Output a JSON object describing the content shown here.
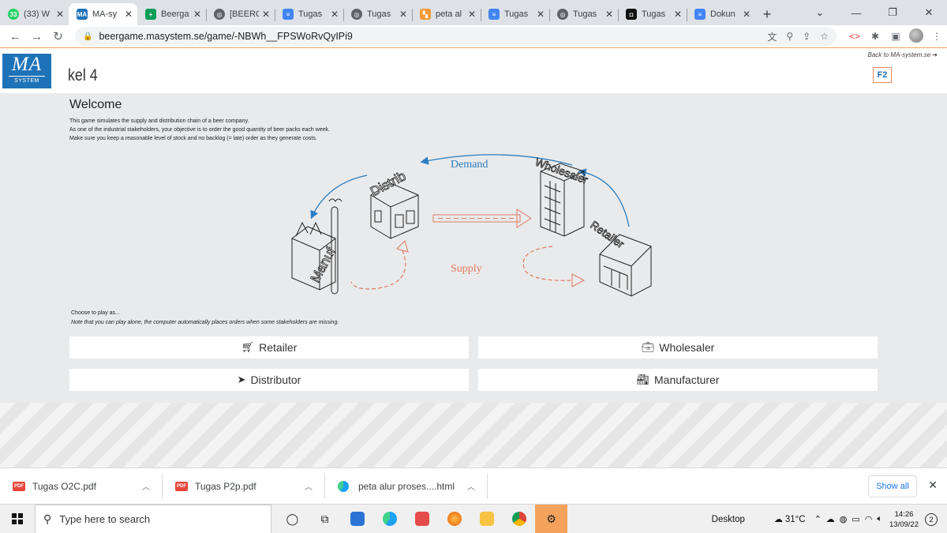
{
  "browser": {
    "tabs": [
      {
        "title": "(33) W",
        "fav_text": "33",
        "fav_color": "#25d366"
      },
      {
        "title": "MA-sy",
        "fav_text": "MA",
        "fav_color": "#1e73b8",
        "active": true
      },
      {
        "title": "Beerga",
        "fav_text": "+",
        "fav_color": "#0f9d58"
      },
      {
        "title": "[BEERG",
        "fav_text": "◎",
        "fav_color": "#5f6368"
      },
      {
        "title": "Tugas",
        "fav_text": "≡",
        "fav_color": "#4285f4"
      },
      {
        "title": "Tugas",
        "fav_text": "◎",
        "fav_color": "#5f6368"
      },
      {
        "title": "peta al",
        "fav_text": "▚",
        "fav_color": "#f29b38"
      },
      {
        "title": "Tugas",
        "fav_text": "≡",
        "fav_color": "#4285f4"
      },
      {
        "title": "Tugas",
        "fav_text": "◎",
        "fav_color": "#5f6368"
      },
      {
        "title": "Tugas",
        "fav_text": "◘",
        "fav_color": "#111111"
      },
      {
        "title": "Dokun",
        "fav_text": "≡",
        "fav_color": "#4285f4"
      }
    ],
    "new_tab": "+",
    "url": "beergame.masystem.se/game/-NBWh__FPSWoRvQyIPi9"
  },
  "page": {
    "logo_text": "MA",
    "logo_sub": "SYSTEM",
    "game_name": "kel 4",
    "back_link": "Back to MA-system.se ➔",
    "flag_text": "F2",
    "welcome_title": "Welcome",
    "intro_lines": [
      "This game simulates the supply and distribution chain of a beer company.",
      "As one of the industrial stakeholders, your objective is to order the good quantity of beer packs each week.",
      "Make sure you keep a reasonable level of stock and no backlog (= late) order as they generate costs."
    ],
    "diagram": {
      "demand": "Demand",
      "supply": "Supply",
      "distrib": "Distrib",
      "manuf": "Manuf",
      "wholesaler": "Wholesaler",
      "retailer": "Retailer"
    },
    "choose_text": "Choose to play as...",
    "choose_note": "Note that you can play alone, the computer automatically places orders when some stakeholders are missing.",
    "roles": {
      "retailer": "Retailer",
      "wholesaler": "Wholesaler",
      "distributor": "Distributor",
      "manufacturer": "Manufacturer"
    }
  },
  "downloads": {
    "items": [
      {
        "name": "Tugas O2C.pdf",
        "badge": "PDF"
      },
      {
        "name": "Tugas P2p.pdf",
        "badge": "PDF"
      },
      {
        "name": "peta alur proses....html"
      }
    ],
    "show_all": "Show all"
  },
  "taskbar": {
    "search_placeholder": "Type here to search",
    "desktop_label": "Desktop",
    "temperature": "31°C",
    "time": "14:26",
    "date": "13/09/22",
    "notifications": "2"
  }
}
